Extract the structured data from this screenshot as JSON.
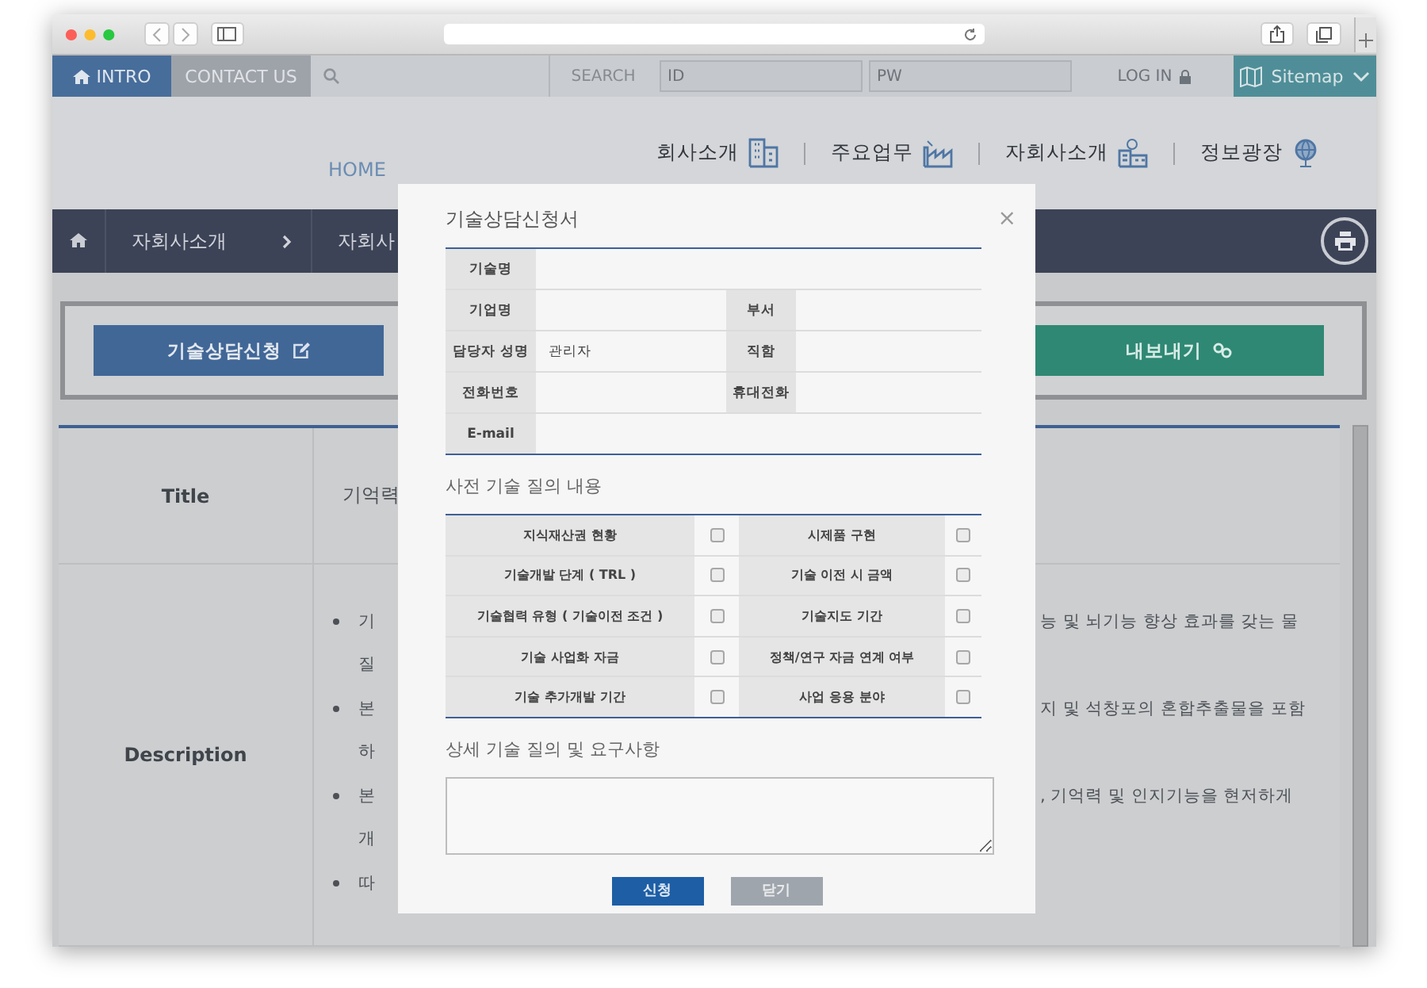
{
  "top_bar": {
    "intro": "INTRO",
    "contact": "CONTACT US",
    "search_label": "SEARCH",
    "id_placeholder": "ID",
    "pw_placeholder": "PW",
    "login": "LOG IN",
    "sitemap": "Sitemap"
  },
  "nav": {
    "home": "HOME",
    "items": [
      {
        "label": "회사소개"
      },
      {
        "label": "주요업무"
      },
      {
        "label": "자회사소개"
      },
      {
        "label": "정보광장"
      }
    ]
  },
  "breadcrumb": [
    "자회사소개",
    "자회사"
  ],
  "actions": [
    {
      "label": "기술상담신청",
      "kind": "apply"
    },
    {
      "label": "내보내기",
      "kind": "export"
    }
  ],
  "detail": {
    "title_label": "Title",
    "title_value": "기억력",
    "description_label": "Description",
    "lines": [
      {
        "bullet": true,
        "left": "기",
        "right": "능 및 뇌기능 향상 효과를 갖는 물"
      },
      {
        "bullet": false,
        "left": "질"
      },
      {
        "bullet": true,
        "left": "본",
        "right": "지 및 석창포의 혼합추출물을 포함"
      },
      {
        "bullet": false,
        "left": "하"
      },
      {
        "bullet": true,
        "left": "본",
        "right": ", 기억력 및 인지기능을 현저하게"
      },
      {
        "bullet": false,
        "left": "개"
      },
      {
        "bullet": true,
        "left": "따"
      }
    ]
  },
  "modal": {
    "title": "기술상담신청서",
    "close": "×",
    "form_rows": [
      [
        {
          "label": "기술명"
        }
      ],
      [
        {
          "label": "기업명"
        },
        {
          "label": "부서"
        }
      ],
      [
        {
          "label": "담당자 성명",
          "value": "관리자"
        },
        {
          "label": "직함"
        }
      ],
      [
        {
          "label": "전화번호"
        },
        {
          "label": "휴대전화"
        }
      ],
      [
        {
          "label": "E-mail"
        }
      ]
    ],
    "inquiries": {
      "title": "사전 기술 질의 내용",
      "items": [
        {
          "label": "지식재산권 현황",
          "checked": false
        },
        {
          "label": "시제품 구현",
          "checked": false
        },
        {
          "label": "기술개발 단계 ( TRL )",
          "checked": false
        },
        {
          "label": "기술 이전 시 금액",
          "checked": false
        },
        {
          "label": "기술협력 유형 ( 기술이전 조건 )",
          "checked": false
        },
        {
          "label": "기술지도 기간",
          "checked": false
        },
        {
          "label": "기술 사업화 자금",
          "checked": false
        },
        {
          "label": "정책/연구 자금 연계 여부",
          "checked": false
        },
        {
          "label": "기술 추가개발 기간",
          "checked": false
        },
        {
          "label": "사업 응용 분야",
          "checked": false
        }
      ]
    },
    "details_title": "상세 기술 질의 및 요구사항",
    "buttons": [
      {
        "label": "신청",
        "kind": "primary"
      },
      {
        "label": "닫기",
        "kind": "secondary"
      }
    ]
  }
}
